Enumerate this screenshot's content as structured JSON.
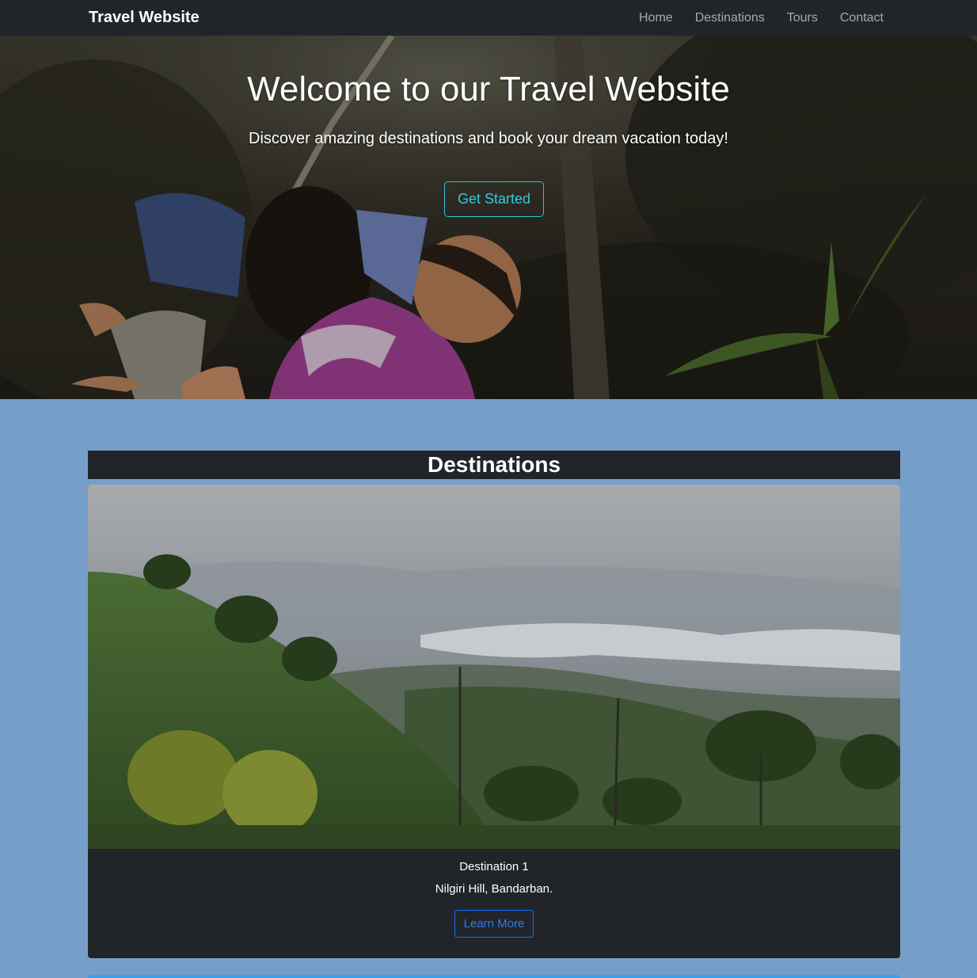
{
  "navbar": {
    "brand": "Travel Website",
    "links": [
      "Home",
      "Destinations",
      "Tours",
      "Contact"
    ]
  },
  "hero": {
    "title": "Welcome to our Travel Website",
    "subtitle": "Discover amazing destinations and book your dream vacation today!",
    "cta_label": "Get Started"
  },
  "destinations": {
    "heading": "Destinations",
    "cards": [
      {
        "name": "Destination 1",
        "location": "Nilgiri Hill, Bandarban.",
        "button_label": "Learn More"
      }
    ]
  },
  "colors": {
    "navbar_bg": "#212529",
    "page_bg": "#759fc9",
    "cta_border": "#2ec1d8",
    "learn_more": "#0d6efd"
  }
}
